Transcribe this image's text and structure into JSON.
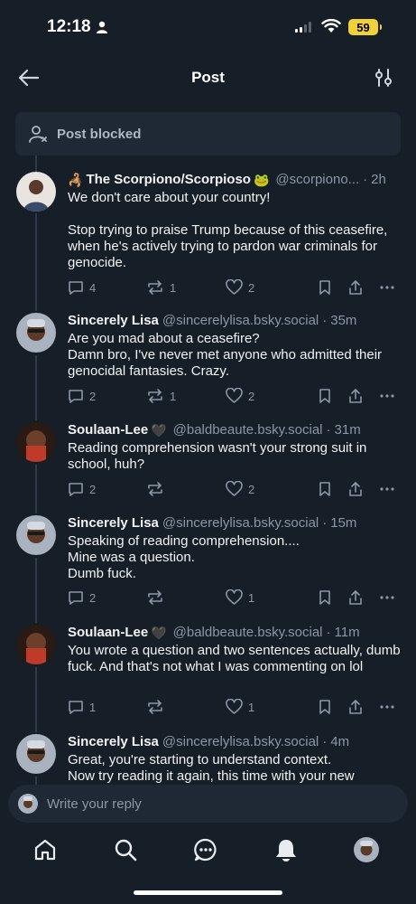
{
  "status": {
    "time": "12:18",
    "battery": "59"
  },
  "header": {
    "title": "Post"
  },
  "blocked": {
    "label": "Post blocked"
  },
  "posts": [
    {
      "name": "The Scorpiono/Scorpioso",
      "name_prefix_emoji": "🦂",
      "name_suffix_emoji": "🐸",
      "handle": "@scorpiono...",
      "time": "2h",
      "body": "We don't care about your country!\n\nStop trying to praise Trump because of this ceasefire, when he's actively trying to pardon war criminals for genocide.",
      "replies": "4",
      "reposts": "1",
      "likes": "2"
    },
    {
      "name": "Sincerely Lisa",
      "handle": "@sincerelylisa.bsky.social",
      "time": "35m",
      "body": "Are you mad about a ceasefire?\nDamn bro, I've never met anyone who admitted their genocidal fantasies. Crazy.",
      "replies": "2",
      "reposts": "1",
      "likes": "2"
    },
    {
      "name": "Soulaan-Lee",
      "name_suffix_emoji": "🖤",
      "handle": "@baldbeaute.bsky.social",
      "time": "31m",
      "body": "Reading comprehension wasn't your strong suit in school, huh?",
      "replies": "2",
      "reposts": "",
      "likes": "2"
    },
    {
      "name": "Sincerely Lisa",
      "handle": "@sincerelylisa.bsky.social",
      "time": "15m",
      "body": "Speaking of reading comprehension....\nMine was a question.\nDumb fuck.",
      "replies": "2",
      "reposts": "",
      "likes": "1"
    },
    {
      "name": "Soulaan-Lee",
      "name_suffix_emoji": "🖤",
      "handle": "@baldbeaute.bsky.social",
      "time": "11m",
      "body": "You wrote a question and two sentences actually, dumb fuck.  And that's not what I was commenting on lol",
      "replies": "1",
      "reposts": "",
      "likes": "1"
    },
    {
      "name": "Sincerely Lisa",
      "handle": "@sincerelylisa.bsky.social",
      "time": "4m",
      "body": "Great, you're starting to understand context.\nNow try reading it again, this time with your new"
    }
  ],
  "reply": {
    "placeholder": "Write your reply"
  },
  "tabs": [
    "home-icon",
    "search-icon",
    "chat-icon",
    "bell-icon",
    "profile-avatar"
  ],
  "colors": {
    "background": "#161e27",
    "card": "#1e2935",
    "muted": "#8a97a6"
  }
}
